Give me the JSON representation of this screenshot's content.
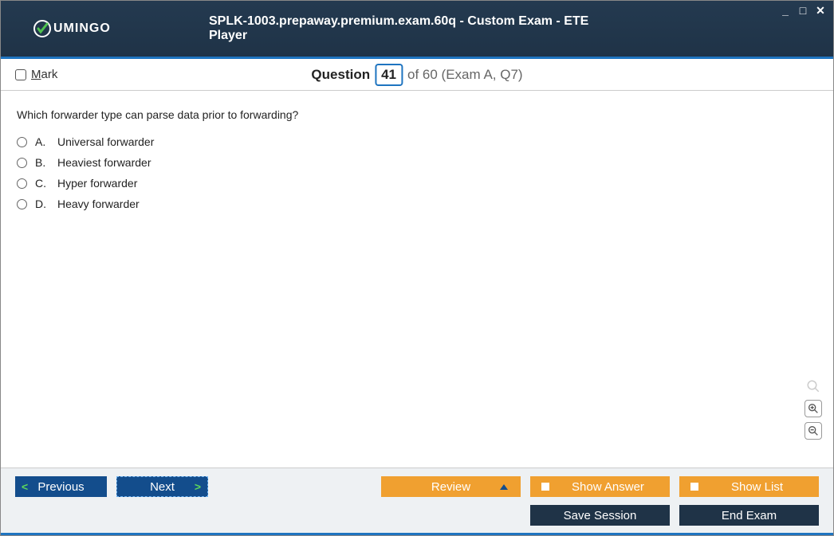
{
  "window": {
    "title": "SPLK-1003.prepaway.premium.exam.60q - Custom Exam - ETE Player",
    "logo_text": "UMINGO"
  },
  "info": {
    "mark_label": "Mark",
    "question_word": "Question",
    "question_num": "41",
    "of_text": "of 60 (Exam A, Q7)"
  },
  "content": {
    "question": "Which forwarder type can parse data prior to forwarding?",
    "options": [
      {
        "letter": "A.",
        "text": "Universal forwarder"
      },
      {
        "letter": "B.",
        "text": "Heaviest forwarder"
      },
      {
        "letter": "C.",
        "text": "Hyper forwarder"
      },
      {
        "letter": "D.",
        "text": "Heavy forwarder"
      }
    ]
  },
  "footer": {
    "previous": "Previous",
    "next": "Next",
    "review": "Review",
    "show_answer": "Show Answer",
    "show_list": "Show List",
    "save_session": "Save Session",
    "end_exam": "End Exam"
  }
}
